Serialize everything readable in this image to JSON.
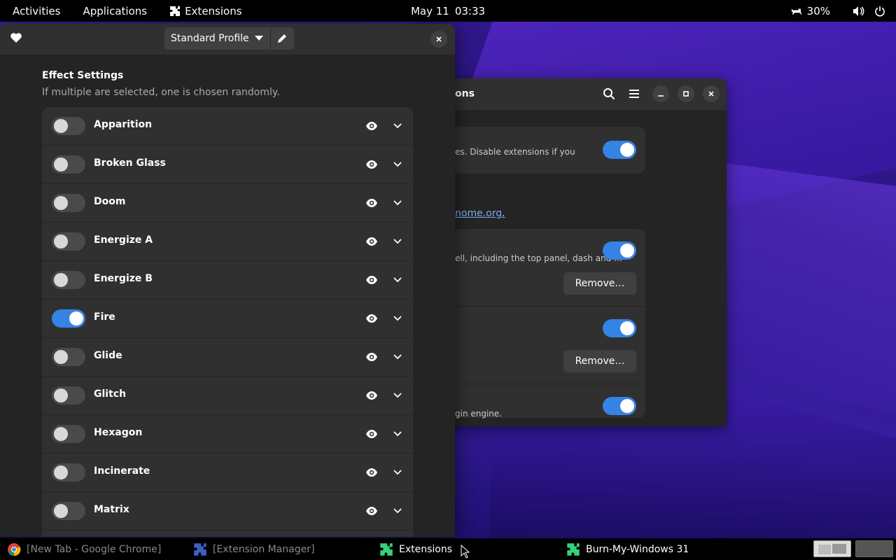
{
  "topbar": {
    "activities": "Activities",
    "applications": "Applications",
    "extensions_menu": "Extensions",
    "date": "May 11",
    "time": "03:33",
    "battery": "30%"
  },
  "back_window": {
    "title_fragment": "ons",
    "card1_text": "es. Disable extensions if you",
    "link_text": "nome.org",
    "link_suffix": ".",
    "card2_text": "ell, including the top panel, dash and …",
    "remove_label": "Remove…",
    "card3_text": "gin engine."
  },
  "front_window": {
    "profile": "Standard Profile",
    "section_title": "Effect Settings",
    "section_subtitle": "If multiple are selected, one is chosen randomly.",
    "effects": [
      {
        "name": "Apparition",
        "enabled": false
      },
      {
        "name": "Broken Glass",
        "enabled": false
      },
      {
        "name": "Doom",
        "enabled": false
      },
      {
        "name": "Energize A",
        "enabled": false
      },
      {
        "name": "Energize B",
        "enabled": false
      },
      {
        "name": "Fire",
        "enabled": true
      },
      {
        "name": "Glide",
        "enabled": false
      },
      {
        "name": "Glitch",
        "enabled": false
      },
      {
        "name": "Hexagon",
        "enabled": false
      },
      {
        "name": "Incinerate",
        "enabled": false
      },
      {
        "name": "Matrix",
        "enabled": false
      }
    ]
  },
  "taskbar": {
    "items": [
      {
        "label": "[New Tab - Google Chrome]",
        "icon": "chrome-icon"
      },
      {
        "label": "[Extension Manager]",
        "icon": "puzzle-icon"
      },
      {
        "label": "Extensions",
        "icon": "puzzle-icon"
      },
      {
        "label": "Burn-My-Windows 31",
        "icon": "puzzle-icon"
      }
    ]
  },
  "colors": {
    "accent": "#3584e4",
    "extension_green": "#33d17a",
    "extension_blue": "#3d5fc4"
  }
}
